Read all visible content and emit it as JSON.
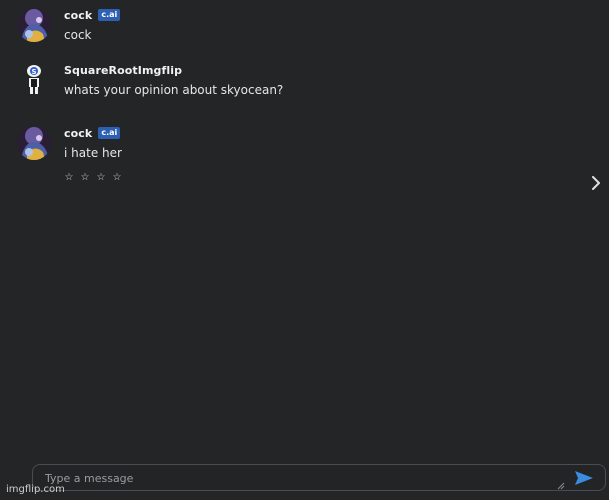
{
  "messages": [
    {
      "author": "cock",
      "tag": "c.ai",
      "text": "cock",
      "avatar_icon": "character-avatar-icon"
    },
    {
      "author": "SquareRootImgflip",
      "tag": "",
      "text": "whats your opinion about skyocean?",
      "avatar_icon": "user-avatar-icon"
    },
    {
      "author": "cock",
      "tag": "c.ai",
      "text": "i hate her",
      "avatar_icon": "character-avatar-icon"
    }
  ],
  "rating": {
    "stars": [
      "☆",
      "☆",
      "☆",
      "☆"
    ]
  },
  "navigation": {
    "next_icon": "chevron-right-icon"
  },
  "composer": {
    "placeholder": "Type a message",
    "value": "",
    "send_icon": "send-icon",
    "send_color": "#3a8dde"
  },
  "watermark": "imgflip.com",
  "colors": {
    "background": "#242526",
    "tag_background": "#2d5fb3",
    "input_border": "#4a4c50"
  }
}
